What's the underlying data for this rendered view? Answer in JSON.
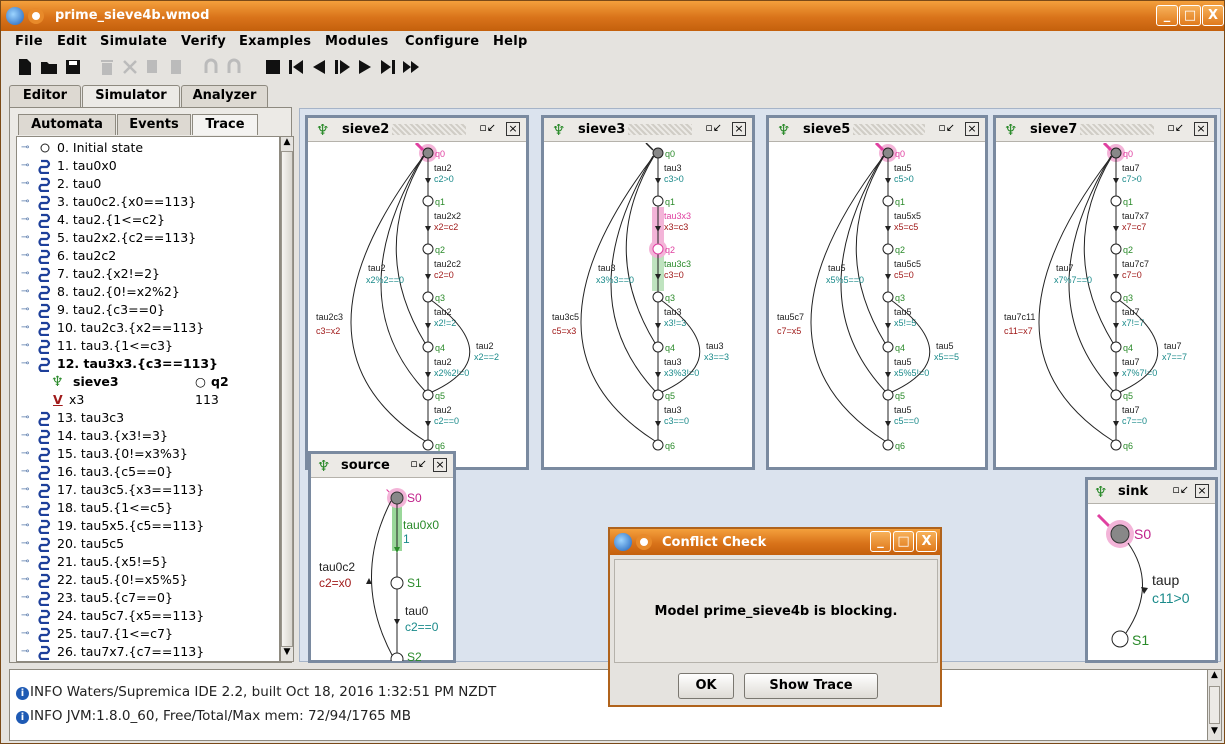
{
  "window": {
    "title": "prime_sieve4b.wmod",
    "min": "_",
    "max": "□",
    "close": "X"
  },
  "menu": [
    "File",
    "Edit",
    "Simulate",
    "Verify",
    "Examples",
    "Modules",
    "Configure",
    "Help"
  ],
  "tabs": [
    "Editor",
    "Simulator",
    "Analyzer"
  ],
  "subtabs": [
    "Automata",
    "Events",
    "Trace"
  ],
  "trace": [
    {
      "label": "0. Initial state",
      "kind": "state"
    },
    {
      "label": "1. tau0x0",
      "kind": "event"
    },
    {
      "label": "2. tau0",
      "kind": "event"
    },
    {
      "label": "3. tau0c2.{x0==113}",
      "kind": "event"
    },
    {
      "label": "4. tau2.{1<=c2}",
      "kind": "event"
    },
    {
      "label": "5. tau2x2.{c2==113}",
      "kind": "event"
    },
    {
      "label": "6. tau2c2",
      "kind": "event"
    },
    {
      "label": "7. tau2.{x2!=2}",
      "kind": "event"
    },
    {
      "label": "8. tau2.{0!=x2%2}",
      "kind": "event"
    },
    {
      "label": "9. tau2.{c3==0}",
      "kind": "event"
    },
    {
      "label": "10. tau2c3.{x2==113}",
      "kind": "event"
    },
    {
      "label": "11. tau3.{1<=c3}",
      "kind": "event"
    },
    {
      "label": "12. tau3x3.{c3==113}",
      "kind": "event",
      "bold": true
    },
    {
      "label": "13. tau3c3",
      "kind": "event"
    },
    {
      "label": "14. tau3.{x3!=3}",
      "kind": "event"
    },
    {
      "label": "15. tau3.{0!=x3%3}",
      "kind": "event"
    },
    {
      "label": "16. tau3.{c5==0}",
      "kind": "event"
    },
    {
      "label": "17. tau3c5.{x3==113}",
      "kind": "event"
    },
    {
      "label": "18. tau5.{1<=c5}",
      "kind": "event"
    },
    {
      "label": "19. tau5x5.{c5==113}",
      "kind": "event"
    },
    {
      "label": "20. tau5c5",
      "kind": "event"
    },
    {
      "label": "21. tau5.{x5!=5}",
      "kind": "event"
    },
    {
      "label": "22. tau5.{0!=x5%5}",
      "kind": "event"
    },
    {
      "label": "23. tau5.{c7==0}",
      "kind": "event"
    },
    {
      "label": "24. tau5c7.{x5==113}",
      "kind": "event"
    },
    {
      "label": "25. tau7.{1<=c7}",
      "kind": "event"
    },
    {
      "label": "26. tau7x7.{c7==113}",
      "kind": "event"
    }
  ],
  "trace_detail": {
    "automaton": "sieve3",
    "state": "q2",
    "variable": "x3",
    "value": "113"
  },
  "automata": {
    "sieve2": {
      "name": "sieve2",
      "n": "2",
      "loop_guard": "x2%2==0",
      "reset": "c3=x2"
    },
    "sieve3": {
      "name": "sieve3",
      "n": "3",
      "loop_guard": "x3%3==0",
      "reset": "c5=x3"
    },
    "sieve5": {
      "name": "sieve5",
      "n": "5",
      "loop_guard": "x5%5==0",
      "reset": "c7=x5"
    },
    "sieve7": {
      "name": "sieve7",
      "n": "7",
      "loop_guard": "x7%7==0",
      "reset": "c11=x7"
    },
    "source": {
      "name": "source"
    },
    "sink": {
      "name": "sink"
    }
  },
  "log": [
    "INFO  Waters/Supremica IDE 2.2, built Oct 18, 2016 1:32:51 PM NZDT",
    "INFO  JVM:1.8.0_60, Free/Total/Max mem: 72/94/1765 MB"
  ],
  "dialog": {
    "title": "Conflict Check",
    "message": "Model prime_sieve4b is blocking.",
    "ok": "OK",
    "show_trace": "Show Trace"
  },
  "colors": {
    "title_orange": "#d9731a",
    "accent_pink": "#e040a0",
    "guard_teal": "#1a8a8a",
    "action_red": "#a01a1a",
    "state_green": "#2a8a2a"
  }
}
